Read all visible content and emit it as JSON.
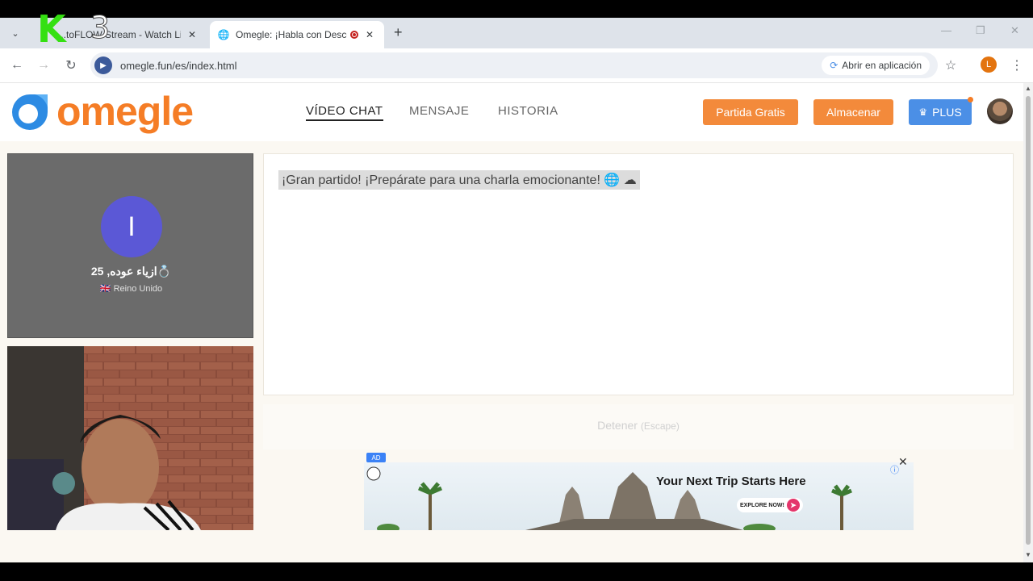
{
  "browser": {
    "tabs": [
      {
        "title": "...toFLOW Stream - Watch Li",
        "favicon": "stream-icon",
        "active": false
      },
      {
        "title": "Omegle: ¡Habla con Descon",
        "favicon": "globe-icon",
        "active": true
      }
    ],
    "new_tab": "+",
    "url": "omegle.fun/es/index.html",
    "open_in_app": "Abrir en aplicación",
    "profile_initial": "L"
  },
  "site": {
    "logo_text": "omegle",
    "nav": [
      "VÍDEO CHAT",
      "MENSAJE",
      "HISTORIA"
    ],
    "buttons": {
      "partida": "Partida Gratis",
      "almacenar": "Almacenar",
      "plus": "PLUS"
    },
    "colors": {
      "brand_orange": "#f57d26",
      "plus_blue": "#4b8fe6",
      "avatar_purple": "#5b58d6"
    }
  },
  "stranger": {
    "initial": "I",
    "name": "ازياء عوده, 25",
    "ring_emoji": "💍",
    "flag": "🇬🇧",
    "country": "Reino Unido"
  },
  "chat": {
    "message": "¡Gran partido! ¡Prepárate para una charla emocionante! 🌐 ☁"
  },
  "controls": {
    "stop_label": "Detener",
    "stop_key": "(Escape)"
  },
  "ad": {
    "badge": "AD",
    "headline": "Your Next Trip Starts Here",
    "cta": "EXPLORE NOW!",
    "close": "✕",
    "info": "ⓘ"
  },
  "watermark": {
    "k": "K",
    "three": "3"
  }
}
